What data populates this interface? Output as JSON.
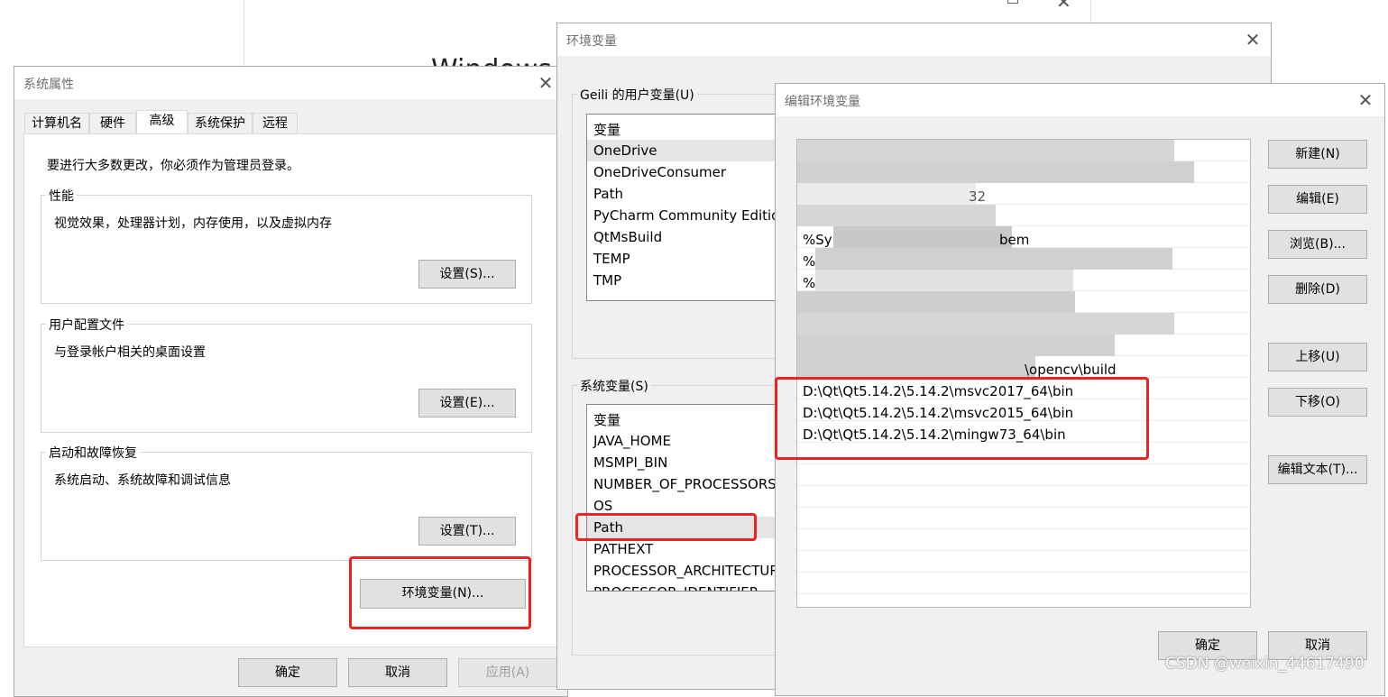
{
  "background_window": {
    "title_fragment": "Windows 设"
  },
  "system_properties": {
    "title": "系统属性",
    "tabs": [
      {
        "label": "计算机名"
      },
      {
        "label": "硬件"
      },
      {
        "label": "高级"
      },
      {
        "label": "系统保护"
      },
      {
        "label": "远程"
      }
    ],
    "admin_note": "要进行大多数更改，你必须作为管理员登录。",
    "performance": {
      "group_label": "性能",
      "description": "视觉效果，处理器计划，内存使用，以及虚拟内存",
      "button_label": "设置(S)..."
    },
    "user_profiles": {
      "group_label": "用户配置文件",
      "description": "与登录帐户相关的桌面设置",
      "button_label": "设置(E)..."
    },
    "startup_recovery": {
      "group_label": "启动和故障恢复",
      "description": "系统启动、系统故障和调试信息",
      "button_label": "设置(T)..."
    },
    "env_vars_button": "环境变量(N)...",
    "ok_label": "确定",
    "cancel_label": "取消",
    "apply_label": "应用(A)"
  },
  "environment_variables": {
    "title": "环境变量",
    "user_group_label": "Geili 的用户变量(U)",
    "user_list_header": "变量",
    "user_vars": [
      {
        "name": "OneDrive"
      },
      {
        "name": "OneDriveConsumer"
      },
      {
        "name": "Path"
      },
      {
        "name": "PyCharm Community Editio"
      },
      {
        "name": "QtMsBuild"
      },
      {
        "name": "TEMP"
      },
      {
        "name": "TMP"
      }
    ],
    "system_group_label": "系统变量(S)",
    "system_list_header": "变量",
    "system_vars": [
      {
        "name": "JAVA_HOME"
      },
      {
        "name": "MSMPI_BIN"
      },
      {
        "name": "NUMBER_OF_PROCESSORS"
      },
      {
        "name": "OS"
      },
      {
        "name": "Path"
      },
      {
        "name": "PATHEXT"
      },
      {
        "name": "PROCESSOR_ARCHITECTUR"
      },
      {
        "name": "PROCESSOR_IDENTIFIER"
      }
    ]
  },
  "edit_env_var": {
    "title": "编辑环境变量",
    "visible_fragments": {
      "row1": "32",
      "row5_prefix": "%Sy",
      "row5_suffix": "bem",
      "row6_prefix": "%",
      "row7_prefix": "%",
      "row11_suffix": "\\opencv\\build"
    },
    "paths": [
      "D:\\Qt\\Qt5.14.2\\5.14.2\\msvc2017_64\\bin",
      "D:\\Qt\\Qt5.14.2\\5.14.2\\msvc2015_64\\bin",
      "D:\\Qt\\Qt5.14.2\\5.14.2\\mingw73_64\\bin"
    ],
    "buttons": {
      "new": "新建(N)",
      "edit": "编辑(E)",
      "browse": "浏览(B)...",
      "delete": "删除(D)",
      "move_up": "上移(U)",
      "move_down": "下移(O)",
      "edit_text": "编辑文本(T)..."
    },
    "ok_label": "确定",
    "cancel_label": "取消"
  },
  "watermark": "CSDN @weixin_44617490",
  "colors": {
    "highlight_box": "#ee2222",
    "dialog_bg": "#f0f0f0",
    "button_bg": "#e1e1e1",
    "selected_row": "#e5e5e5"
  },
  "icons": {
    "close": "close-icon",
    "maximize": "maximize-icon"
  }
}
